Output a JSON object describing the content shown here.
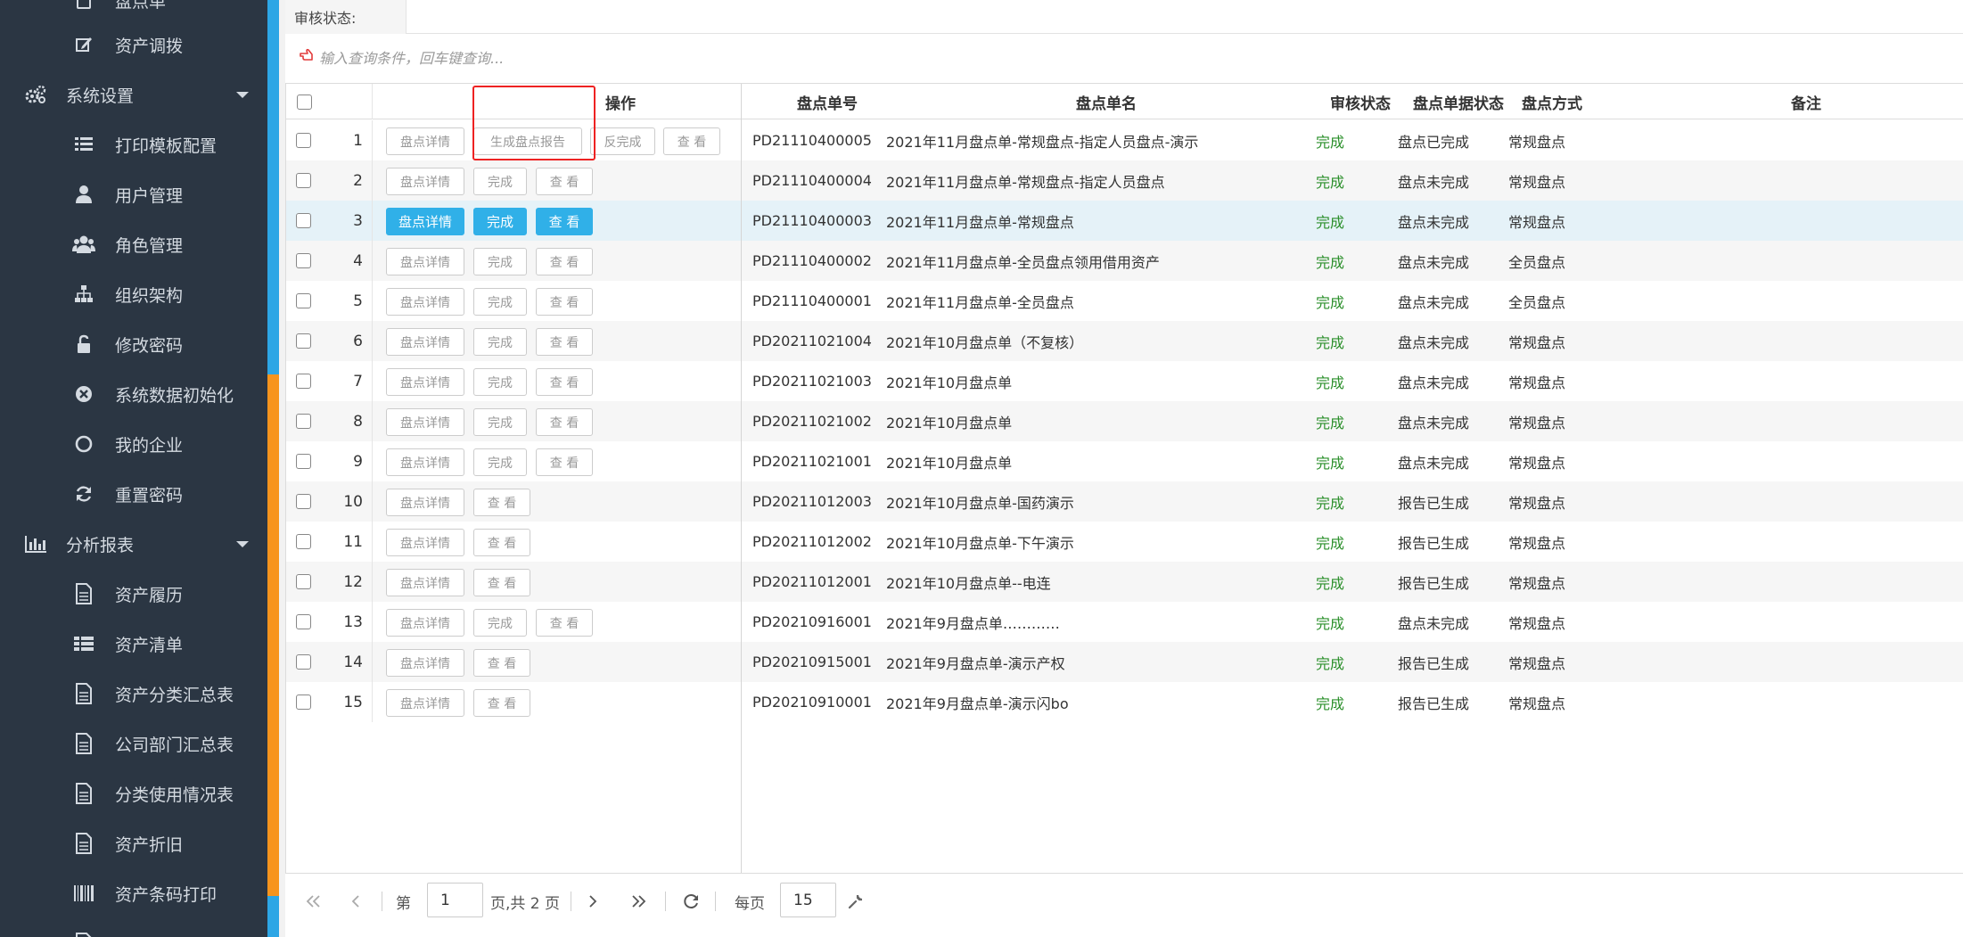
{
  "sidebar": {
    "items": [
      {
        "label": "盘点单",
        "icon": "clipboard-icon",
        "type": "sub"
      },
      {
        "label": "资产调拨",
        "icon": "edit-icon",
        "type": "sub"
      },
      {
        "label": "系统设置",
        "icon": "gears-icon",
        "type": "group"
      },
      {
        "label": "打印模板配置",
        "icon": "list-icon",
        "type": "sub"
      },
      {
        "label": "用户管理",
        "icon": "user-icon",
        "type": "sub"
      },
      {
        "label": "角色管理",
        "icon": "users-icon",
        "type": "sub"
      },
      {
        "label": "组织架构",
        "icon": "sitemap-icon",
        "type": "sub"
      },
      {
        "label": "修改密码",
        "icon": "unlock-icon",
        "type": "sub"
      },
      {
        "label": "系统数据初始化",
        "icon": "times-circle-icon",
        "type": "sub"
      },
      {
        "label": "我的企业",
        "icon": "circle-icon",
        "type": "sub"
      },
      {
        "label": "重置密码",
        "icon": "refresh-icon",
        "type": "sub"
      },
      {
        "label": "分析报表",
        "icon": "bar-chart-icon",
        "type": "group"
      },
      {
        "label": "资产履历",
        "icon": "file-icon",
        "type": "sub"
      },
      {
        "label": "资产清单",
        "icon": "th-list-icon",
        "type": "sub"
      },
      {
        "label": "资产分类汇总表",
        "icon": "file-icon",
        "type": "sub"
      },
      {
        "label": "公司部门汇总表",
        "icon": "file-icon",
        "type": "sub"
      },
      {
        "label": "分类使用情况表",
        "icon": "file-icon",
        "type": "sub"
      },
      {
        "label": "资产折旧",
        "icon": "file-icon",
        "type": "sub"
      },
      {
        "label": "资产条码打印",
        "icon": "barcode-icon",
        "type": "sub"
      },
      {
        "label": "",
        "icon": "file-icon",
        "type": "sub"
      }
    ]
  },
  "filter": {
    "audit_status_label": "审核状态:"
  },
  "search": {
    "placeholder": "输入查询条件，回车键查询..."
  },
  "grid": {
    "columns": {
      "ops": "操作",
      "code": "盘点单号",
      "name": "盘点单名",
      "audit": "审核状态",
      "doc_status": "盘点单据状态",
      "method": "盘点方式",
      "remark": "备注"
    },
    "buttons": {
      "detail": "盘点详情",
      "report": "生成盘点报告",
      "unfinish": "反完成",
      "finish": "完成",
      "view": "查 看"
    },
    "rows": [
      {
        "no": "1",
        "code": "PD21110400005",
        "name": "2021年11月盘点单-常规盘点-指定人员盘点-演示",
        "audit": "完成",
        "doc_status": "盘点已完成",
        "method": "常规盘点",
        "actions": "report"
      },
      {
        "no": "2",
        "code": "PD21110400004",
        "name": "2021年11月盘点单-常规盘点-指定人员盘点",
        "audit": "完成",
        "doc_status": "盘点未完成",
        "method": "常规盘点",
        "actions": "finish"
      },
      {
        "no": "3",
        "code": "PD21110400003",
        "name": "2021年11月盘点单-常规盘点",
        "audit": "完成",
        "doc_status": "盘点未完成",
        "method": "常规盘点",
        "actions": "finish",
        "selected": true
      },
      {
        "no": "4",
        "code": "PD21110400002",
        "name": "2021年11月盘点单-全员盘点领用借用资产",
        "audit": "完成",
        "doc_status": "盘点未完成",
        "method": "全员盘点",
        "actions": "finish"
      },
      {
        "no": "5",
        "code": "PD21110400001",
        "name": "2021年11月盘点单-全员盘点",
        "audit": "完成",
        "doc_status": "盘点未完成",
        "method": "全员盘点",
        "actions": "finish"
      },
      {
        "no": "6",
        "code": "PD20211021004",
        "name": "2021年10月盘点单（不复核）",
        "audit": "完成",
        "doc_status": "盘点未完成",
        "method": "常规盘点",
        "actions": "finish"
      },
      {
        "no": "7",
        "code": "PD20211021003",
        "name": "2021年10月盘点单",
        "audit": "完成",
        "doc_status": "盘点未完成",
        "method": "常规盘点",
        "actions": "finish"
      },
      {
        "no": "8",
        "code": "PD20211021002",
        "name": "2021年10月盘点单",
        "audit": "完成",
        "doc_status": "盘点未完成",
        "method": "常规盘点",
        "actions": "finish"
      },
      {
        "no": "9",
        "code": "PD20211021001",
        "name": "2021年10月盘点单",
        "audit": "完成",
        "doc_status": "盘点未完成",
        "method": "常规盘点",
        "actions": "finish"
      },
      {
        "no": "10",
        "code": "PD20211012003",
        "name": "2021年10月盘点单-国药演示",
        "audit": "完成",
        "doc_status": "报告已生成",
        "method": "常规盘点",
        "actions": "view"
      },
      {
        "no": "11",
        "code": "PD20211012002",
        "name": "2021年10月盘点单-下午演示",
        "audit": "完成",
        "doc_status": "报告已生成",
        "method": "常规盘点",
        "actions": "view"
      },
      {
        "no": "12",
        "code": "PD20211012001",
        "name": "2021年10月盘点单--电连",
        "audit": "完成",
        "doc_status": "报告已生成",
        "method": "常规盘点",
        "actions": "view"
      },
      {
        "no": "13",
        "code": "PD20210916001",
        "name": "2021年9月盘点单…………",
        "audit": "完成",
        "doc_status": "盘点未完成",
        "method": "常规盘点",
        "actions": "finish"
      },
      {
        "no": "14",
        "code": "PD20210915001",
        "name": "2021年9月盘点单-演示产权",
        "audit": "完成",
        "doc_status": "报告已生成",
        "method": "常规盘点",
        "actions": "view"
      },
      {
        "no": "15",
        "code": "PD20210910001",
        "name": "2021年9月盘点单-演示闪bo",
        "audit": "完成",
        "doc_status": "报告已生成",
        "method": "常规盘点",
        "actions": "view"
      }
    ]
  },
  "pager": {
    "page_prefix": "第",
    "current_page": "1",
    "page_suffix": "页,共 2 页",
    "per_page_label": "每页",
    "per_page": "15"
  },
  "colors": {
    "sidebar_bg": "#2b3643",
    "accent_blue": "#30b0e8",
    "accent_orange": "#f7941d",
    "status_green": "#2a8f2a",
    "annotation_red": "#e22222"
  }
}
